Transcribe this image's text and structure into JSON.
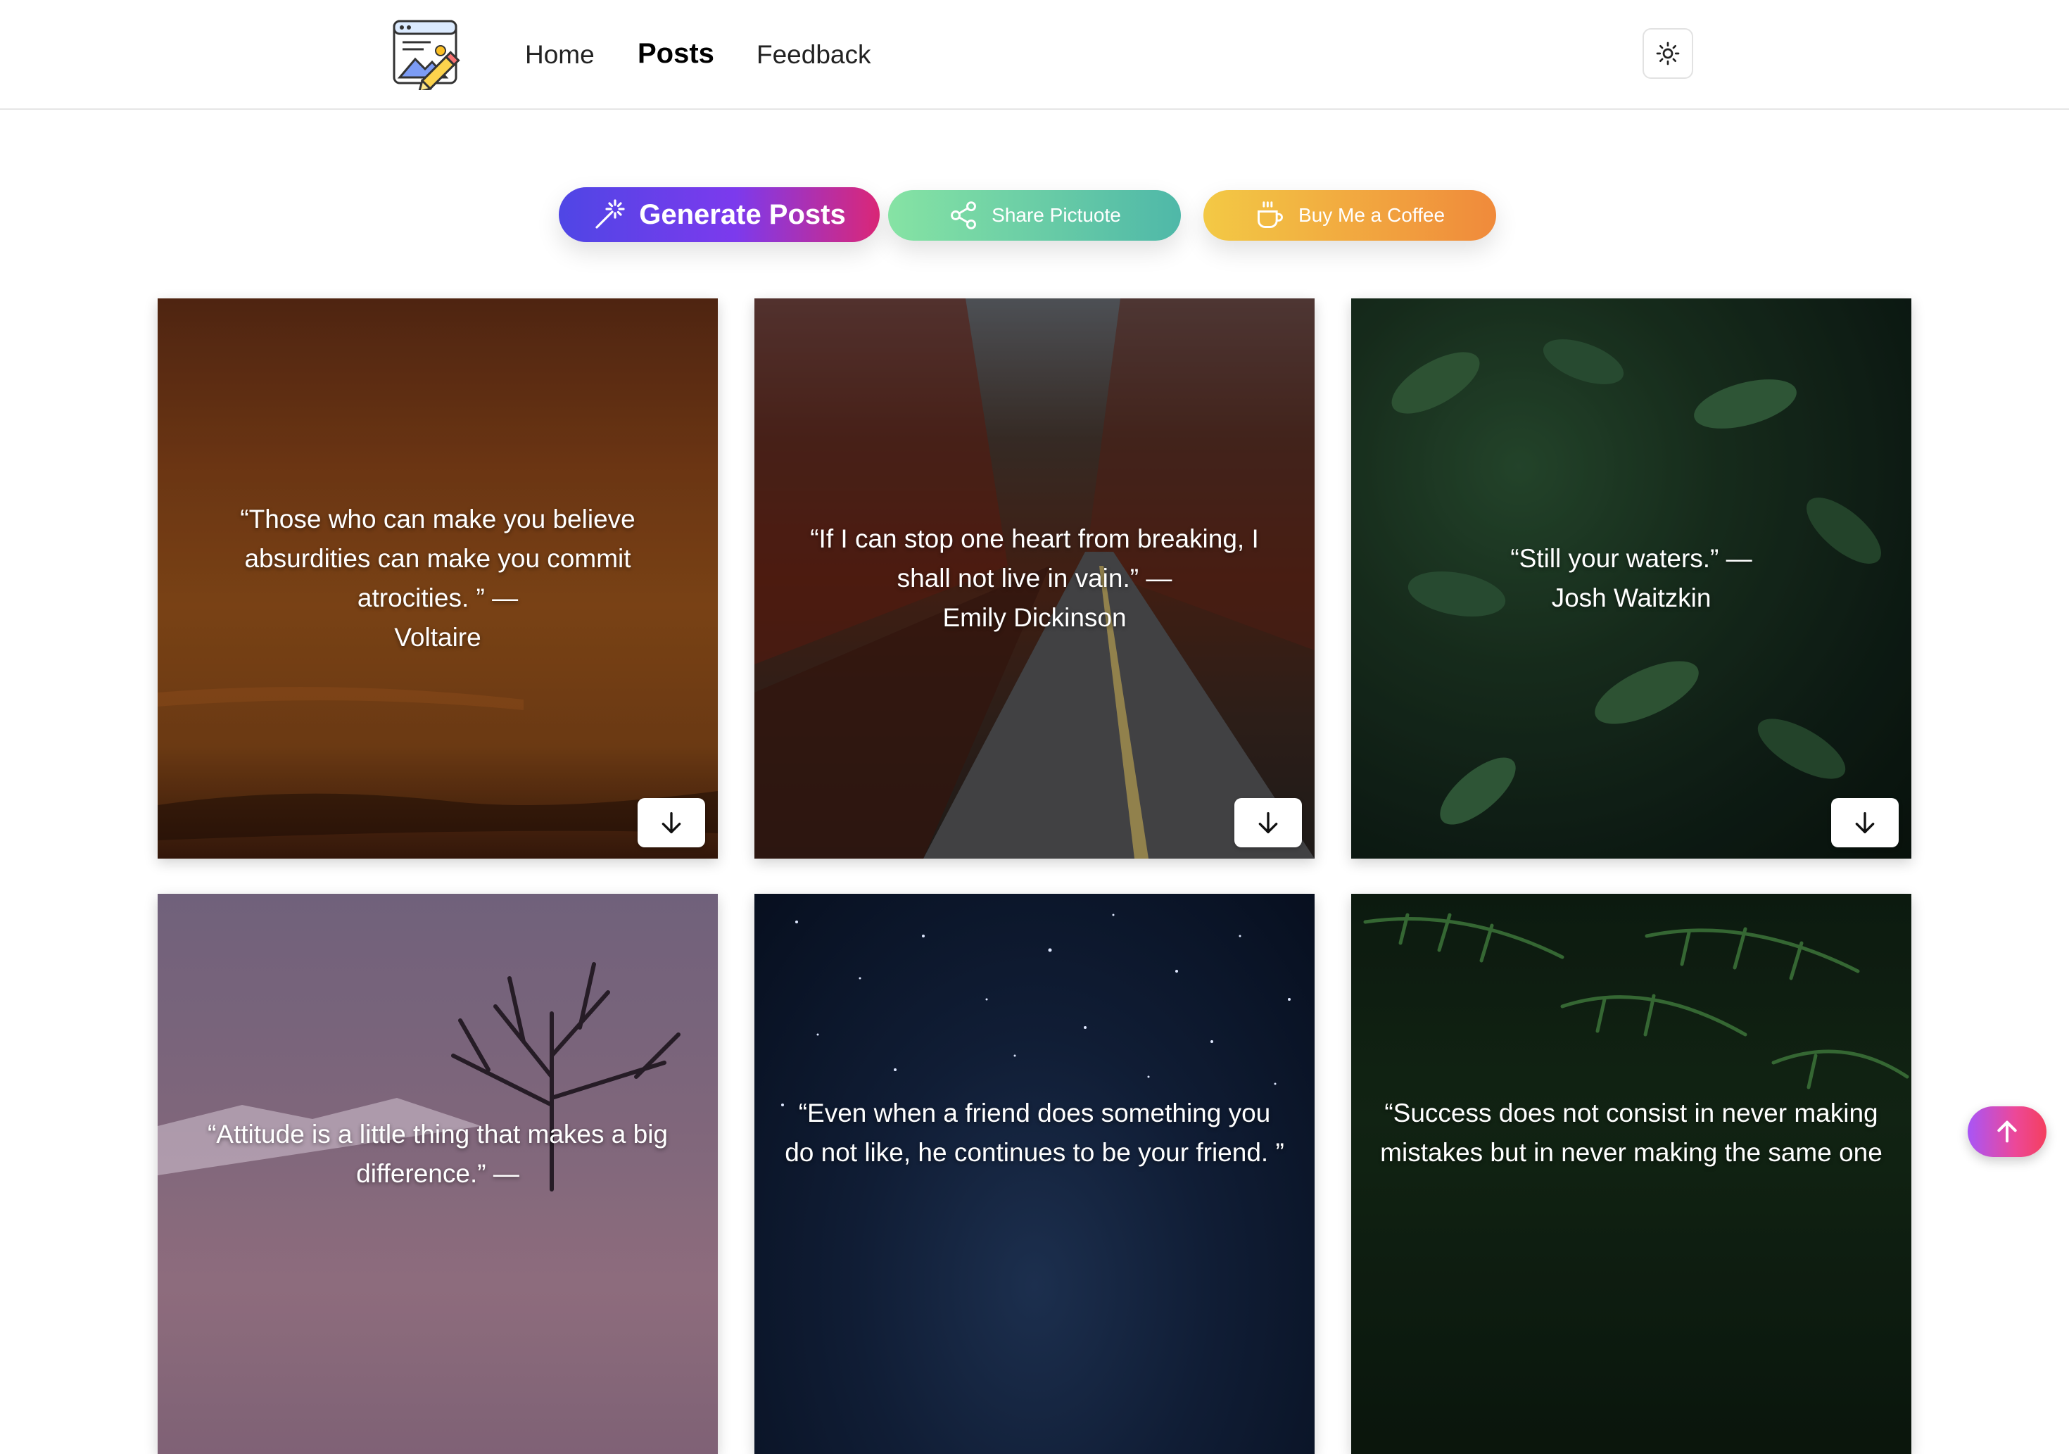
{
  "nav": {
    "logo_icon": "image-edit-icon",
    "links": [
      "Home",
      "Posts",
      "Feedback"
    ],
    "active": "Posts",
    "theme_icon": "sun-icon"
  },
  "actions": {
    "generate": {
      "label": "Generate Posts",
      "icon": "magic-wand-icon"
    },
    "share": {
      "label": "Share Pictuote",
      "icon": "share-icon"
    },
    "coffee": {
      "label": "Buy Me a Coffee",
      "icon": "coffee-cup-icon"
    }
  },
  "posts": [
    {
      "quote": "“Those who can make you believe absurdities can make you commit atrocities. ” —",
      "author": "Voltaire",
      "theme": "sunset-sky",
      "download_icon": "arrow-down-icon"
    },
    {
      "quote": "“If I can stop one heart from breaking, I shall not live in vain.” —",
      "author": "Emily Dickinson",
      "theme": "autumn-road",
      "download_icon": "arrow-down-icon"
    },
    {
      "quote": "“Still your waters.” —",
      "author": "Josh Waitzkin",
      "theme": "green-leaves",
      "download_icon": "arrow-down-icon"
    },
    {
      "quote": "“Attitude is a little thing that makes a big difference.” —",
      "author": "",
      "theme": "purple-mountain-tree"
    },
    {
      "quote": "“Even when a friend does something you do not like, he continues to be your friend. ”",
      "author": "",
      "theme": "starry-night"
    },
    {
      "quote": "“Success does not consist in never making mistakes but in never making the same one",
      "author": "",
      "theme": "fern-forest"
    }
  ],
  "colors": {
    "generate_gradient": [
      "#4f46e5",
      "#7c3aed",
      "#db2777"
    ],
    "share_gradient": [
      "#86e3a4",
      "#4fb8a8"
    ],
    "coffee_gradient": [
      "#f3c945",
      "#f08a3b"
    ],
    "scroll_top_gradient": [
      "#a855f7",
      "#ec4899",
      "#f43f5e"
    ]
  },
  "scroll_top_icon": "arrow-up-icon"
}
